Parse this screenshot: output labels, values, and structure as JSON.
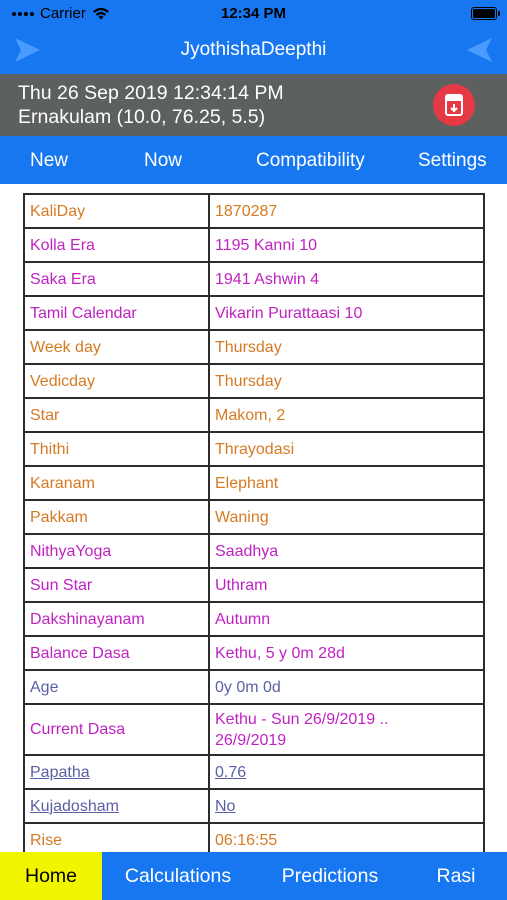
{
  "status": {
    "carrier": "Carrier",
    "time": "12:34 PM"
  },
  "header": {
    "title": "JyothishaDeepthi"
  },
  "info": {
    "date": "Thu 26 Sep 2019 12:34:14 PM",
    "place": "Ernakulam (10.0, 76.25, 5.5)"
  },
  "menu": {
    "new": "New",
    "now": "Now",
    "compatibility": "Compatibility",
    "settings": "Settings"
  },
  "rows": [
    {
      "label": "KaliDay",
      "value": "1870287"
    },
    {
      "label": "Kolla Era",
      "value": "1195 Kanni 10"
    },
    {
      "label": "Saka Era",
      "value": "1941 Ashwin 4"
    },
    {
      "label": "Tamil Calendar",
      "value": "Vikarin Purattaasi 10"
    },
    {
      "label": "Week day",
      "value": "Thursday"
    },
    {
      "label": "Vedicday",
      "value": "Thursday"
    },
    {
      "label": "Star",
      "value": "Makom, 2"
    },
    {
      "label": "Thithi",
      "value": "Thrayodasi"
    },
    {
      "label": "Karanam",
      "value": "Elephant"
    },
    {
      "label": "Pakkam",
      "value": "Waning"
    },
    {
      "label": "NithyaYoga",
      "value": "Saadhya"
    },
    {
      "label": "Sun Star",
      "value": "Uthram"
    },
    {
      "label": "Dakshinayanam",
      "value": "Autumn"
    },
    {
      "label": "Balance Dasa",
      "value": "Kethu, 5 y 0m 28d"
    },
    {
      "label": "Age",
      "value": "0y 0m 0d"
    },
    {
      "label": "Current Dasa",
      "value_line1": "Kethu - Sun 26/9/2019 ..",
      "value_line2": "26/9/2019"
    },
    {
      "label": "Papatha",
      "value": "0.76"
    },
    {
      "label": "Kujadosham",
      "value": "No"
    },
    {
      "label": "Rise",
      "value": "06:16:55"
    }
  ],
  "tabs": {
    "home": "Home",
    "calculations": "Calculations",
    "predictions": "Predictions",
    "rasi": "Rasi"
  },
  "colors": {
    "accent": "#1777f0",
    "info_bar": "#5c605e",
    "active_tab": "#f2f500",
    "pdf_button": "#e53a45"
  },
  "icons": {
    "nav_left": "arrow-right-icon",
    "nav_right": "arrow-left-icon",
    "pdf": "pdf-document-icon"
  }
}
